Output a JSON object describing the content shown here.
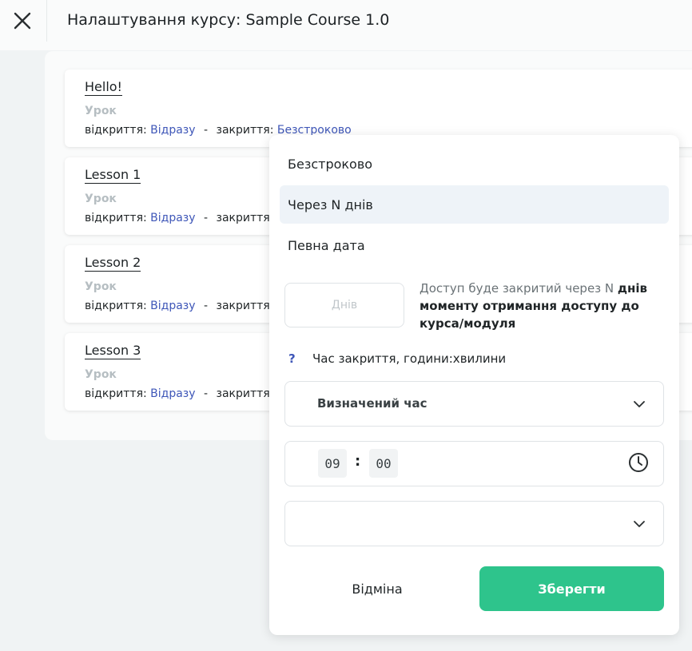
{
  "header": {
    "title": "Налаштування курсу: Sample Course 1.0",
    "close_icon": "close-icon"
  },
  "lessons": [
    {
      "title": "Hello!",
      "type": "Урок",
      "open_label": "відкриття:",
      "open_value": "Відразу",
      "separator": "-",
      "close_label": "закриття:",
      "close_value": "Безстроково"
    },
    {
      "title": "Lesson 1",
      "type": "Урок",
      "open_label": "відкриття:",
      "open_value": "Відразу",
      "separator": "-",
      "close_label": "закриття:",
      "close_value": ""
    },
    {
      "title": "Lesson 2",
      "type": "Урок",
      "open_label": "відкриття:",
      "open_value": "Відразу",
      "separator": "-",
      "close_label": "закриття:",
      "close_value": ""
    },
    {
      "title": "Lesson 3",
      "type": "Урок",
      "open_label": "відкриття:",
      "open_value": "Відразу",
      "separator": "-",
      "close_label": "закриття:",
      "close_value": ""
    }
  ],
  "popover": {
    "options": [
      "Безстроково",
      "Через N днів",
      "Певна дата"
    ],
    "selected_option": "Через N днів",
    "days_input": {
      "placeholder": "Днів",
      "value": ""
    },
    "hint_prefix": "Доступ буде закритий через N ",
    "hint_bold": "днів моменту отримання доступу до курса/модуля",
    "help_icon": "?",
    "time_label": "Час закриття, години:хвилини",
    "time_mode": "Визначений час",
    "time": {
      "hours": "09",
      "separator": ":",
      "minutes": "00"
    },
    "extra_select_value": "",
    "cancel_label": "Відміна",
    "save_label": "Зберегти"
  },
  "colors": {
    "accent": "#2ec48c",
    "link": "#3f57b8",
    "selected_bg": "#eef3f8",
    "background": "#f0f3f4"
  }
}
